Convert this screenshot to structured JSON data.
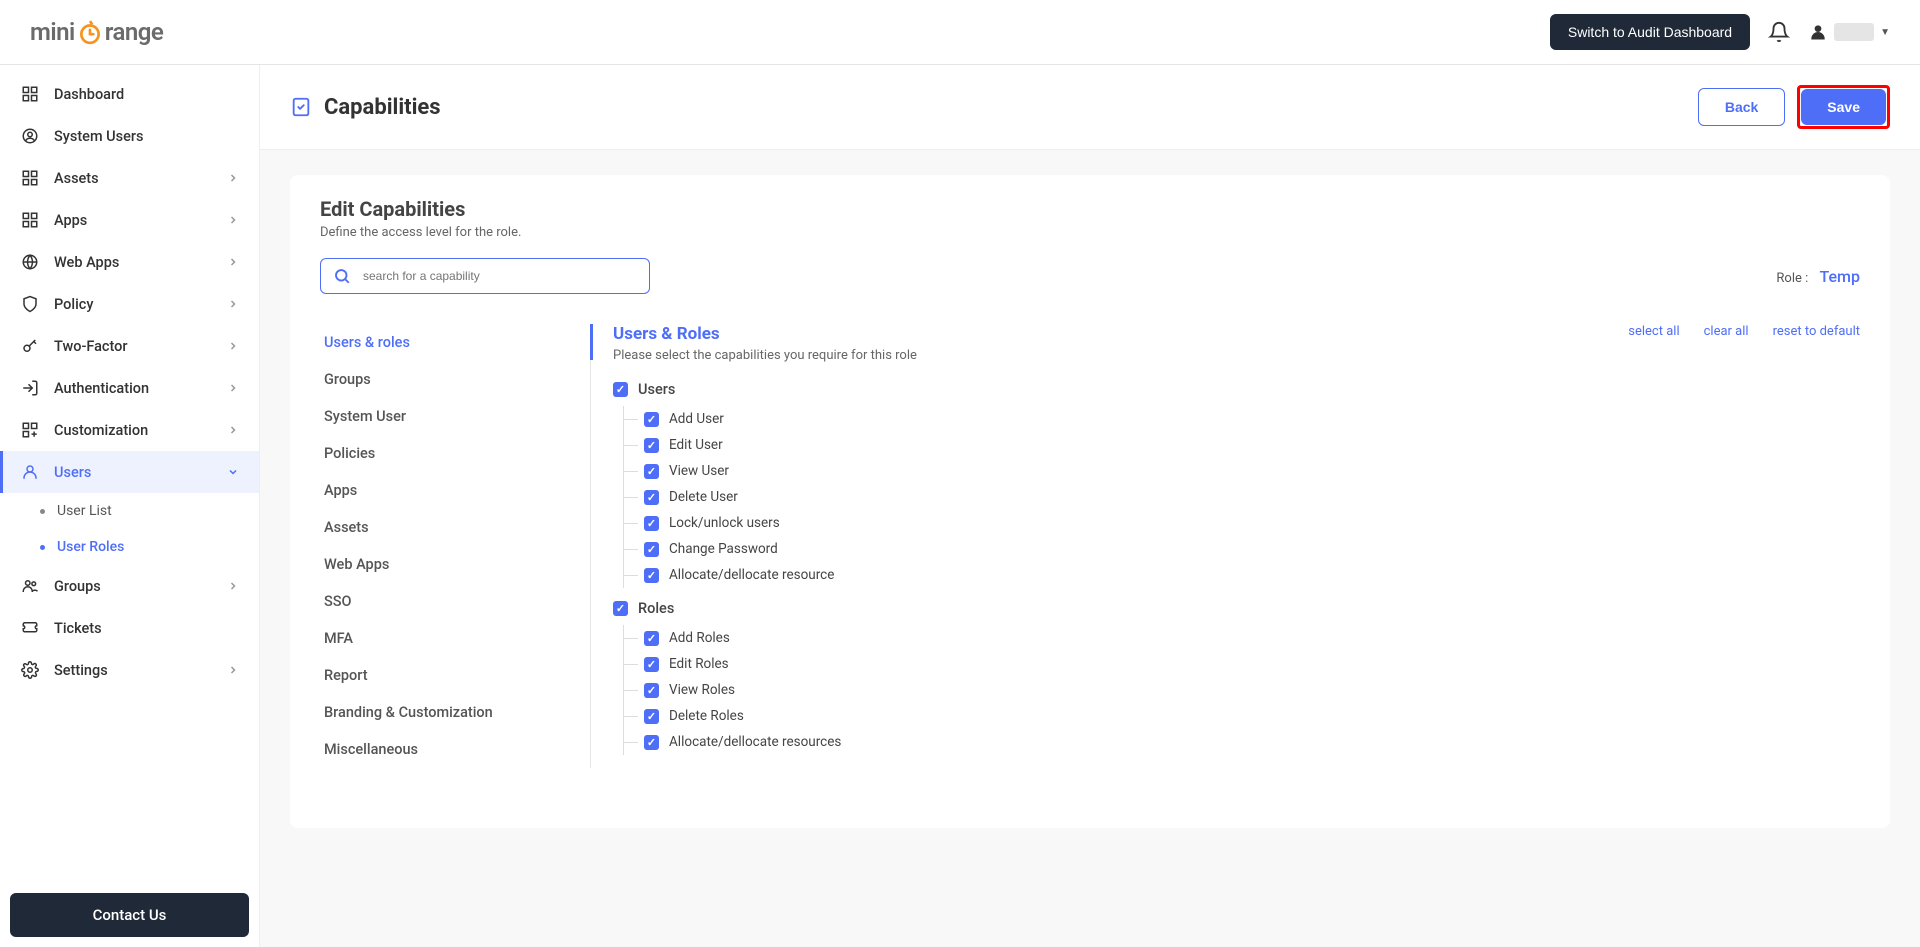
{
  "header": {
    "logo_prefix": "mini",
    "logo_suffix": "range",
    "switch_button": "Switch to Audit Dashboard"
  },
  "sidebar": {
    "items": [
      {
        "label": "Dashboard",
        "icon": "dashboard",
        "expandable": false
      },
      {
        "label": "System Users",
        "icon": "user-circle",
        "expandable": false
      },
      {
        "label": "Assets",
        "icon": "assets",
        "expandable": true
      },
      {
        "label": "Apps",
        "icon": "apps",
        "expandable": true
      },
      {
        "label": "Web Apps",
        "icon": "globe",
        "expandable": true
      },
      {
        "label": "Policy",
        "icon": "shield",
        "expandable": true
      },
      {
        "label": "Two-Factor",
        "icon": "key",
        "expandable": true
      },
      {
        "label": "Authentication",
        "icon": "login",
        "expandable": true
      },
      {
        "label": "Customization",
        "icon": "grid-add",
        "expandable": true
      },
      {
        "label": "Users",
        "icon": "user",
        "expandable": true,
        "active": true,
        "expanded": true,
        "children": [
          {
            "label": "User List"
          },
          {
            "label": "User Roles",
            "active": true
          }
        ]
      },
      {
        "label": "Groups",
        "icon": "groups",
        "expandable": true
      },
      {
        "label": "Tickets",
        "icon": "ticket",
        "expandable": false
      },
      {
        "label": "Settings",
        "icon": "settings",
        "expandable": true
      }
    ],
    "contact_button": "Contact Us"
  },
  "page": {
    "title": "Capabilities",
    "back_button": "Back",
    "save_button": "Save"
  },
  "card": {
    "title": "Edit Capabilities",
    "subtitle": "Define the access level for the role.",
    "search_placeholder": "search for a capability",
    "role_label": "Role :",
    "role_name": "Temp"
  },
  "cap_tabs": [
    {
      "label": "Users & roles",
      "active": true
    },
    {
      "label": "Groups"
    },
    {
      "label": "System User"
    },
    {
      "label": "Policies"
    },
    {
      "label": "Apps"
    },
    {
      "label": "Assets"
    },
    {
      "label": "Web Apps"
    },
    {
      "label": "SSO"
    },
    {
      "label": "MFA"
    },
    {
      "label": "Report"
    },
    {
      "label": "Branding & Customization"
    },
    {
      "label": "Miscellaneous"
    }
  ],
  "cap_section": {
    "title": "Users & Roles",
    "subtitle": "Please select the capabilities you require for this role",
    "select_all": "select all",
    "clear_all": "clear all",
    "reset": "reset to default"
  },
  "cap_groups": [
    {
      "label": "Users",
      "items": [
        "Add User",
        "Edit User",
        "View User",
        "Delete User",
        "Lock/unlock users",
        "Change Password",
        "Allocate/dellocate resource"
      ]
    },
    {
      "label": "Roles",
      "items": [
        "Add Roles",
        "Edit Roles",
        "View Roles",
        "Delete Roles",
        "Allocate/dellocate resources"
      ]
    }
  ]
}
